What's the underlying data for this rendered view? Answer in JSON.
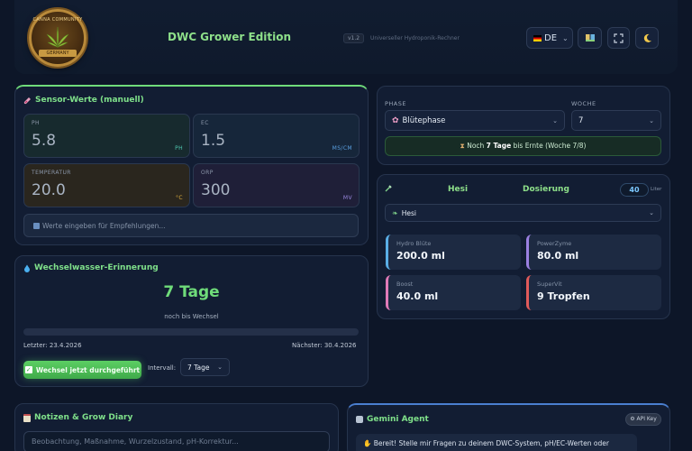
{
  "header": {
    "logo_text_top": "CANNA COMMUNITY",
    "logo_text_banner": "GERMANY",
    "title": "DWC Grower Edition",
    "version": "v1.2",
    "tagline": "Universeller Hydroponik-Rechner",
    "language": "DE",
    "icons": [
      "book-icon",
      "fullscreen-icon",
      "moon-icon"
    ]
  },
  "sensors": {
    "title": "Sensor-Werte (manuell)",
    "ph": {
      "label": "PH",
      "value": "5.8",
      "unit": "PH"
    },
    "ec": {
      "label": "EC",
      "value": "1.5",
      "unit": "MS/CM"
    },
    "temp": {
      "label": "TEMPERATUR",
      "value": "20.0",
      "unit": "°C"
    },
    "orp": {
      "label": "ORP",
      "value": "300",
      "unit": "MV"
    },
    "hint_placeholder": "Werte eingeben für Empfehlungen..."
  },
  "water": {
    "title": "Wechselwasser-Erinnerung",
    "days": "7 Tage",
    "subtitle": "noch bis Wechsel",
    "progress_fraction": 0.0,
    "last_label": "Letzter: 23.4.2026",
    "next_label": "Nächster: 30.4.2026",
    "change_button": "Wechsel jetzt durchgeführt",
    "interval_label": "Intervall:",
    "interval_value": "7 Tage"
  },
  "phase": {
    "phase_label": "PHASE",
    "phase_value": "Blütephase",
    "week_label": "WOCHE",
    "week_value": "7",
    "ernte_prefix": "Noch",
    "ernte_days": "7 Tage",
    "ernte_suffix": "bis Ernte (Woche 7/8)"
  },
  "dosing": {
    "brand": "Hesi",
    "title": "Dosierung",
    "liters": "40",
    "liters_unit": "Liter",
    "select_value": "Hesi",
    "nutrients": [
      {
        "name": "Hydro Blüte",
        "value": "200.0 ml",
        "color": "#5aaee6"
      },
      {
        "name": "PowerZyme",
        "value": "80.0 ml",
        "color": "#9a7fe0"
      },
      {
        "name": "Boost",
        "value": "40.0 ml",
        "color": "#e07ab8"
      },
      {
        "name": "SuperVit",
        "value": "9 Tropfen",
        "color": "#e05a5a"
      }
    ]
  },
  "notes": {
    "title": "Notizen & Grow Diary",
    "placeholder": "Beobachtung, Maßnahme, Wurzelzustand, pH-Korrektur..."
  },
  "gemini": {
    "title": "Gemini Agent",
    "api_button": "API Key",
    "message": "Bereit! Stelle mir Fragen zu deinem DWC-System, pH/EC-Werten oder"
  }
}
